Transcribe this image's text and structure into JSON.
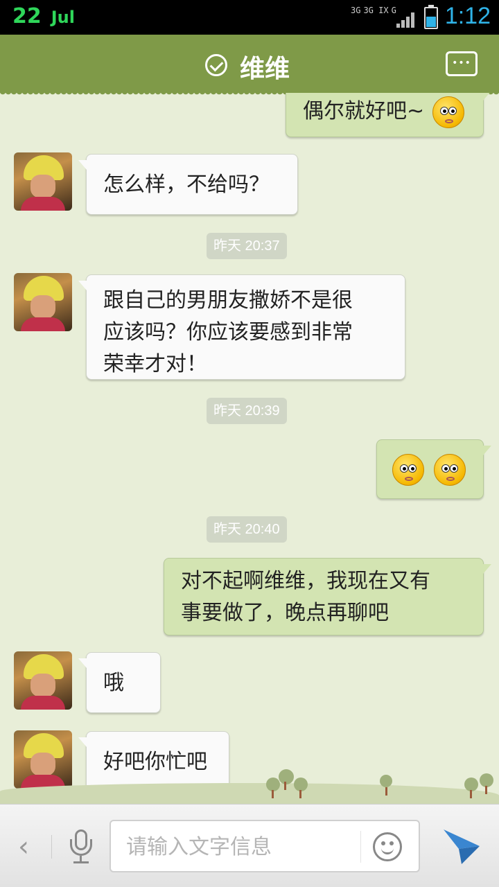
{
  "status_bar": {
    "date_day": "22",
    "date_month": "Jul",
    "network_1": "3G",
    "network_2": "3G IX",
    "network_3": "G",
    "time": "1:12"
  },
  "header": {
    "title": "维维"
  },
  "messages": [
    {
      "side": "right",
      "text": "偶尔就好吧~"
    },
    {
      "side": "left",
      "text": "怎么样，不给吗？"
    },
    {
      "type": "time",
      "text": "昨天 20:37"
    },
    {
      "side": "left",
      "lines": [
        "跟自己的男朋友撒娇不是很",
        "应该吗？你应该要感到非常",
        "荣幸才对！"
      ]
    },
    {
      "type": "time",
      "text": "昨天 20:39"
    },
    {
      "side": "right",
      "emoji_count": 2
    },
    {
      "type": "time",
      "text": "昨天 20:40"
    },
    {
      "side": "right",
      "lines": [
        "对不起啊维维，我现在又有",
        "事要做了，晚点再聊吧"
      ]
    },
    {
      "side": "left",
      "text": "哦"
    },
    {
      "side": "left",
      "text": "好吧你忙吧"
    }
  ],
  "input": {
    "placeholder": "请输入文字信息"
  },
  "colors": {
    "header_bg": "#7f9a48",
    "chat_bg": "#e8eed8",
    "sent_bubble": "#d3e4b2",
    "received_bubble": "#fafafa",
    "status_time": "#2fb3e8",
    "status_date": "#2fd65a",
    "send_icon": "#3a86d0"
  }
}
